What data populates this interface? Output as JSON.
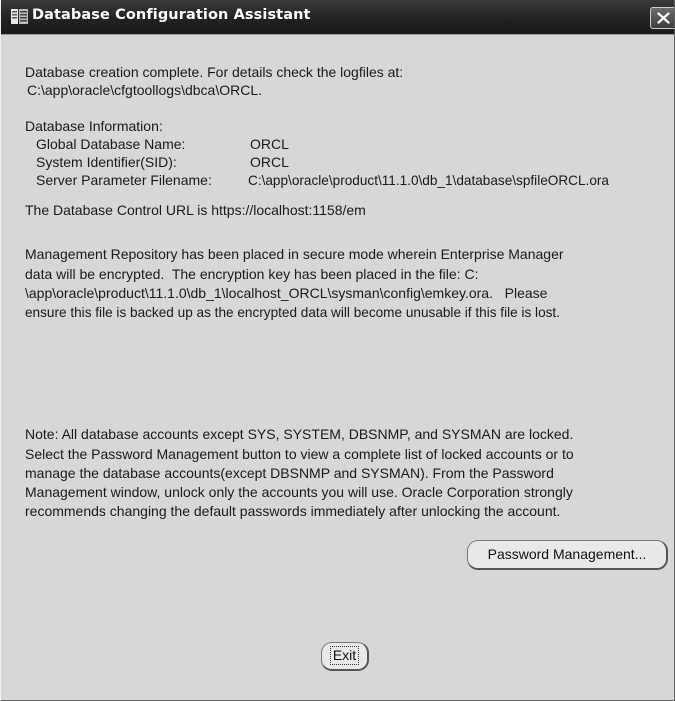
{
  "window": {
    "title": "Database Configuration Assistant",
    "icons": {
      "app": "oracle-dbca-icon",
      "close": "close-icon"
    }
  },
  "completion": {
    "line1": "Database creation complete. For details check the logfiles at:",
    "line2": "C:\\app\\oracle\\cfgtoollogs\\dbca\\ORCL."
  },
  "db_info": {
    "heading": "Database Information:",
    "rows": [
      {
        "label": "Global Database Name:",
        "value": "ORCL"
      },
      {
        "label": "System Identifier(SID):",
        "value": "ORCL"
      },
      {
        "label": "Server Parameter Filename:",
        "value": "C:\\app\\oracle\\product\\11.1.0\\db_1\\database\\spfileORCL.ora"
      }
    ]
  },
  "control_url": "The Database Control URL is https://localhost:1158/em",
  "repository_msg": [
    "Management Repository has been placed in secure mode wherein Enterprise Manager",
    "data will be encrypted.  The encryption key has been placed in the file: C:",
    "\\app\\oracle\\product\\11.1.0\\db_1\\localhost_ORCL\\sysman\\config\\emkey.ora.   Please",
    "ensure this file is backed up as the encrypted data will become unusable if this file is lost."
  ],
  "note_msg": [
    "Note: All database accounts except SYS, SYSTEM, DBSNMP, and SYSMAN are locked.",
    "Select the Password Management button to view a complete list of locked accounts or to",
    "manage the database accounts(except DBSNMP and SYSMAN). From the Password",
    "Management window, unlock only the accounts you will use. Oracle Corporation strongly",
    "recommends changing the default passwords immediately after unlocking the account."
  ],
  "buttons": {
    "password_management": "Password Management...",
    "exit": "Exit"
  }
}
